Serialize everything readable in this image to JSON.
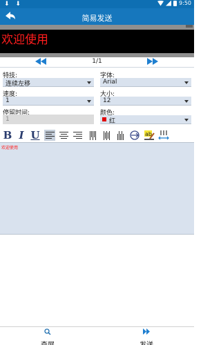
{
  "status_bar": {
    "left_icons": "⬇ ⬇",
    "time": "9:50"
  },
  "header": {
    "title": "简易发送"
  },
  "preview": {
    "text": "欢迎使用"
  },
  "pager": {
    "label": "1/1"
  },
  "fields": {
    "effect": {
      "label": "特技:",
      "value": "连续左移"
    },
    "font": {
      "label": "字体:",
      "value": "Arial"
    },
    "speed": {
      "label": "速度:",
      "value": "1"
    },
    "size": {
      "label": "大小:",
      "value": "12"
    },
    "stay_time": {
      "label": "停留时间:",
      "value": "1"
    },
    "color": {
      "label": "颜色:",
      "value": "红",
      "swatch": "#e00000"
    }
  },
  "toolbar": {
    "bold": "B",
    "italic": "I",
    "underline": "U",
    "abc_icon_text": "ab"
  },
  "editor": {
    "text": "欢迎使用"
  },
  "bottom_nav": {
    "view_screen": "查屏",
    "send": "发送"
  },
  "colors": {
    "primary": "#1677bd",
    "status": "#0e6fb3",
    "input_bg": "#d9e2ee",
    "led_text": "#ff1d1d"
  }
}
